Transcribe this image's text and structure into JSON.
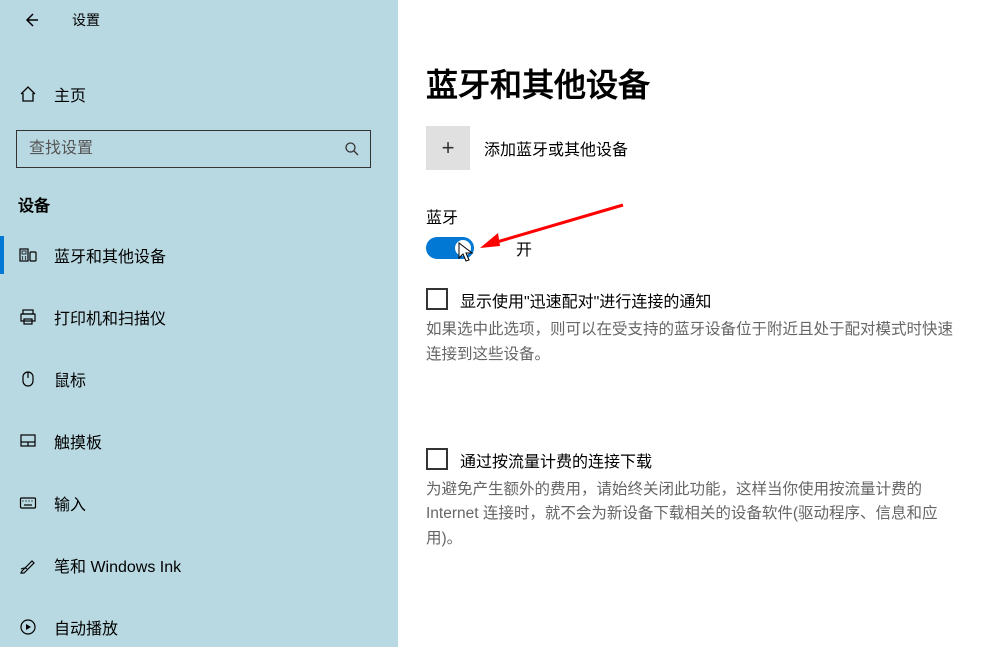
{
  "app_title": "设置",
  "home_label": "主页",
  "search_placeholder": "查找设置",
  "section_header": "设备",
  "nav": [
    {
      "label": "蓝牙和其他设备",
      "icon": "bluetooth-devices-icon",
      "selected": true
    },
    {
      "label": "打印机和扫描仪",
      "icon": "printer-icon",
      "selected": false
    },
    {
      "label": "鼠标",
      "icon": "mouse-icon",
      "selected": false
    },
    {
      "label": "触摸板",
      "icon": "touchpad-icon",
      "selected": false
    },
    {
      "label": "输入",
      "icon": "keyboard-icon",
      "selected": false
    },
    {
      "label": "笔和 Windows Ink",
      "icon": "pen-icon",
      "selected": false
    },
    {
      "label": "自动播放",
      "icon": "autoplay-icon",
      "selected": false
    }
  ],
  "page_title": "蓝牙和其他设备",
  "add_device_label": "添加蓝牙或其他设备",
  "bluetooth_header": "蓝牙",
  "toggle_state_label": "开",
  "checkbox1_label": "显示使用\"迅速配对\"进行连接的通知",
  "checkbox1_desc": "如果选中此选项，则可以在受支持的蓝牙设备位于附近且处于配对模式时快速连接到这些设备。",
  "checkbox2_label": "通过按流量计费的连接下载",
  "checkbox2_desc": "为避免产生额外的费用，请始终关闭此功能，这样当你使用按流量计费的 Internet 连接时，就不会为新设备下载相关的设备软件(驱动程序、信息和应用)。"
}
